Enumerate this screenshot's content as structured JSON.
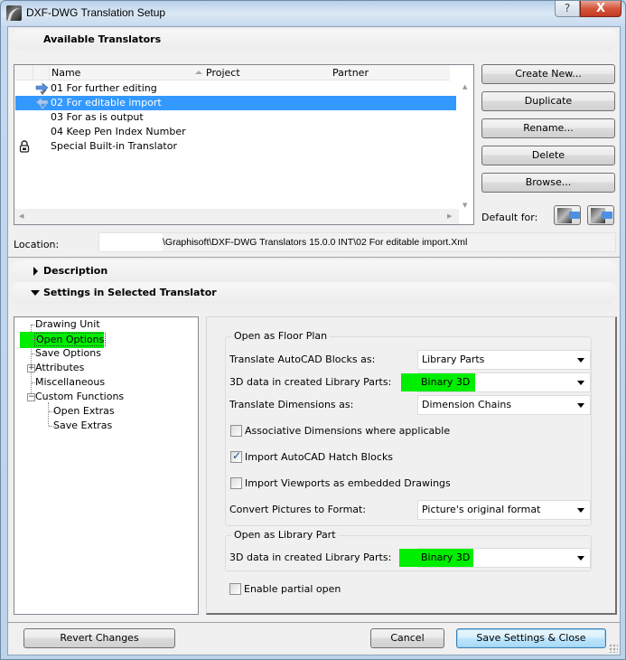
{
  "window": {
    "title": "DXF-DWG Translation Setup",
    "help_label": "?",
    "close_label": "X"
  },
  "available_translators": {
    "header": "Available Translators",
    "columns": [
      "Name",
      "Project",
      "Partner"
    ],
    "rows": [
      {
        "icon": "arrow-right-check-icon",
        "name": "01 For further editing",
        "selected": false
      },
      {
        "icon": "arrow-left-check-icon",
        "name": "02 For editable import",
        "selected": true
      },
      {
        "icon": "",
        "name": "03 For as is output",
        "selected": false
      },
      {
        "icon": "",
        "name": "04 Keep Pen Index Number",
        "selected": false
      },
      {
        "icon": "lock-icon",
        "name": "Special Built-in Translator",
        "selected": false
      }
    ],
    "buttons": {
      "create_new": "Create New...",
      "duplicate": "Duplicate",
      "rename": "Rename...",
      "delete": "Delete",
      "browse": "Browse..."
    },
    "default_for_label": "Default for:"
  },
  "location": {
    "label": "Location:",
    "path": "\\Graphisoft\\DXF-DWG Translators 15.0.0 INT\\02 For editable import.Xml"
  },
  "description": {
    "header": "Description",
    "expanded": false
  },
  "settings": {
    "header": "Settings in Selected Translator",
    "expanded": true,
    "tree": [
      {
        "label": "Drawing Unit",
        "level": 0,
        "expander": ""
      },
      {
        "label": "Open Options",
        "level": 0,
        "expander": "",
        "selected": true
      },
      {
        "label": "Save Options",
        "level": 0,
        "expander": ""
      },
      {
        "label": "Attributes",
        "level": 0,
        "expander": "+"
      },
      {
        "label": "Miscellaneous",
        "level": 0,
        "expander": ""
      },
      {
        "label": "Custom Functions",
        "level": 0,
        "expander": "-"
      },
      {
        "label": "Open Extras",
        "level": 1,
        "expander": ""
      },
      {
        "label": "Save Extras",
        "level": 1,
        "expander": ""
      }
    ],
    "floor_plan": {
      "title": "Open as Floor Plan",
      "translate_blocks_label": "Translate AutoCAD Blocks as:",
      "translate_blocks_value": "Library Parts",
      "data_3d_label": "3D data in created Library Parts:",
      "data_3d_value": "Binary 3D",
      "translate_dims_label": "Translate Dimensions as:",
      "translate_dims_value": "Dimension Chains",
      "assoc_dims_label": "Associative Dimensions where applicable",
      "assoc_dims_checked": false,
      "hatch_blocks_label": "Import AutoCAD Hatch Blocks",
      "hatch_blocks_checked": true,
      "viewports_label": "Import Viewports as embedded Drawings",
      "viewports_checked": false,
      "convert_pictures_label": "Convert Pictures to Format:",
      "convert_pictures_value": "Picture's original format"
    },
    "library_part": {
      "title": "Open as Library Part",
      "data_3d_label": "3D data in created Library Parts:",
      "data_3d_value": "Binary 3D"
    },
    "partial_open_label": "Enable partial open",
    "partial_open_checked": false
  },
  "footer": {
    "revert": "Revert Changes",
    "cancel": "Cancel",
    "save_close": "Save Settings & Close"
  },
  "colors": {
    "selection": "#3399ff",
    "highlight": "#00ee00"
  }
}
